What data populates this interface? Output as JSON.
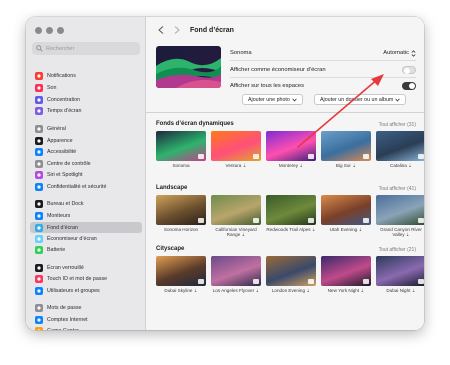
{
  "window": {
    "title": "Fond d’écran"
  },
  "sidebar": {
    "search_placeholder": "Rechercher",
    "items": [
      {
        "label": "Notifications",
        "icon": "bell-icon",
        "color": "#ff3b30"
      },
      {
        "label": "Son",
        "icon": "speaker-icon",
        "color": "#ff2d55"
      },
      {
        "label": "Concentration",
        "icon": "moon-icon",
        "color": "#5e5ce6"
      },
      {
        "label": "Temps d’écran",
        "icon": "hourglass-icon",
        "color": "#7d5ce6"
      },
      {
        "label": "Général",
        "icon": "gear-icon",
        "color": "#8e8e93"
      },
      {
        "label": "Apparence",
        "icon": "appearance-icon",
        "color": "#1c1c1e"
      },
      {
        "label": "Accessibilité",
        "icon": "accessibility-icon",
        "color": "#0a84ff"
      },
      {
        "label": "Centre de contrôle",
        "icon": "control-center-icon",
        "color": "#8e8e93"
      },
      {
        "label": "Siri et Spotlight",
        "icon": "siri-icon",
        "color": "#b44ce0"
      },
      {
        "label": "Confidentialité et sécurité",
        "icon": "hand-icon",
        "color": "#0a84ff"
      },
      {
        "label": "Bureau et Dock",
        "icon": "dock-icon",
        "color": "#1c1c1e"
      },
      {
        "label": "Moniteurs",
        "icon": "display-icon",
        "color": "#0a84ff"
      },
      {
        "label": "Fond d’écran",
        "icon": "wallpaper-icon",
        "color": "#32ade6"
      },
      {
        "label": "Économiseur d’écran",
        "icon": "screensaver-icon",
        "color": "#64d2ff"
      },
      {
        "label": "Batterie",
        "icon": "battery-icon",
        "color": "#30d158"
      },
      {
        "label": "Écran verrouillé",
        "icon": "lock-icon",
        "color": "#1c1c1e"
      },
      {
        "label": "Touch ID et mot de passe",
        "icon": "fingerprint-icon",
        "color": "#ff375f"
      },
      {
        "label": "Utilisateurs et groupes",
        "icon": "users-icon",
        "color": "#0a84ff"
      },
      {
        "label": "Mots de passe",
        "icon": "key-icon",
        "color": "#8e8e93"
      },
      {
        "label": "Comptes Internet",
        "icon": "at-icon",
        "color": "#0a84ff"
      },
      {
        "label": "Game Center",
        "icon": "game-center-icon",
        "color": "#ff9f0a"
      }
    ],
    "selected_index": 12
  },
  "settings": {
    "wallpaper_name": "Sonoma",
    "mode_value": "Automatic",
    "screensaver_label": "Afficher comme économiseur d’écran",
    "screensaver_on": false,
    "all_spaces_label": "Afficher sur tous les espaces",
    "all_spaces_on": true,
    "add_photo": "Ajouter une photo",
    "add_folder": "Ajouter un dossier ou un album"
  },
  "sections": [
    {
      "title": "Fonds d’écran dynamiques",
      "show_all": "Tout afficher (31)",
      "items": [
        "Sonoma",
        "Ventura ⇣",
        "Monterey ⇣",
        "Big Sur ⇣",
        "Catalina ⇣"
      ]
    },
    {
      "title": "Landscape",
      "show_all": "Tout afficher (41)",
      "items": [
        "Sonoma Horizon",
        "Californian Vineyard Range ⇣",
        "Redwoods Trail Alpes ⇣",
        "Utah Evening ⇣",
        "Grand Canyon River Valley ⇣"
      ]
    },
    {
      "title": "Cityscape",
      "show_all": "Tout afficher (21)",
      "items": [
        "Dubai Skyline ⇣",
        "Los Angeles Flyover ⇣",
        "London Evening ⇣",
        "New York Night ⇣",
        "Dubai Night ⇣"
      ]
    }
  ],
  "colors": {
    "annotation_arrow": "#e8383d",
    "toggle_on": "#3a3a3d"
  }
}
